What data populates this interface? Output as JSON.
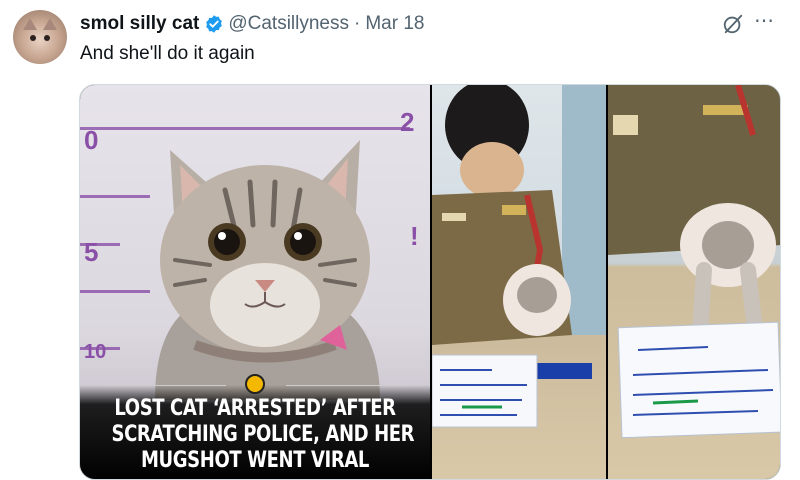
{
  "tweet": {
    "display_name": "smol silly cat",
    "handle": "@Catsillyness",
    "separator": "·",
    "date": "Mar 18",
    "text": "And she'll do it again",
    "more_icon": "⋯"
  },
  "media": {
    "caption": [
      "LOST CAT ‘ARRESTED’ AFTER",
      "SCRATCHING POLICE, AND HER",
      "MUGSHOT WENT VIRAL"
    ],
    "height_chart_marks": {
      "top_left": "0",
      "top_right": "2",
      "middle_left": "5",
      "middle_right": "!",
      "bottom_left": "10"
    }
  },
  "colors": {
    "verified": "#1d9bf0",
    "muted": "#536471",
    "text": "#0f1419",
    "chart_marker": "#8a4fa6"
  },
  "icons": {
    "verified": "verified-badge-icon",
    "grok": "grok-icon",
    "more": "more-icon"
  }
}
